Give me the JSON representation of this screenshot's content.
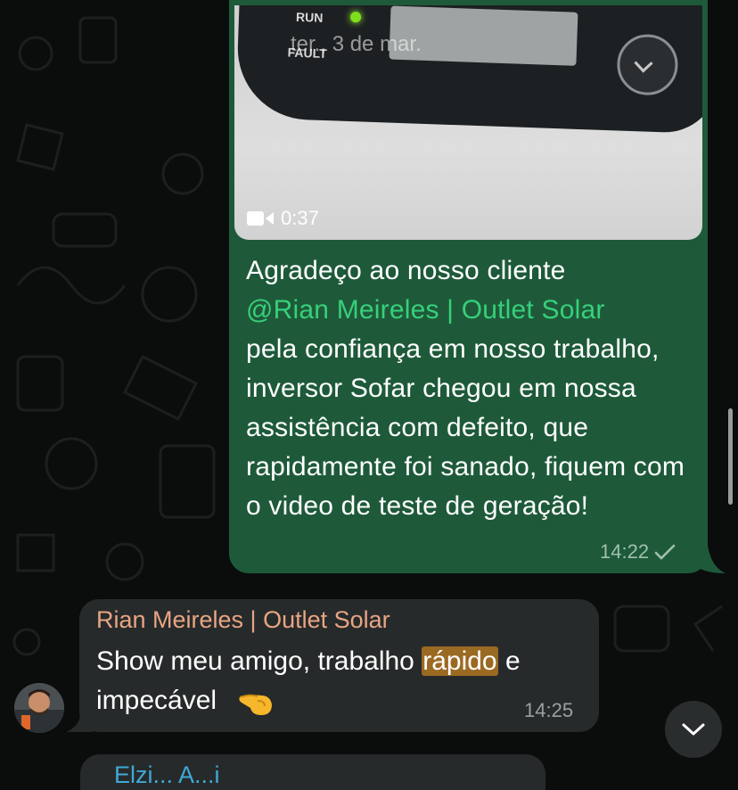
{
  "outgoing": {
    "video": {
      "duration": "0:37",
      "date_overlay": "ter., 3 de mar.",
      "device_labels": [
        "RUN",
        "FAULT"
      ]
    },
    "text_before": "Agradeço ao nosso cliente",
    "mention": "@Rian Meireles | Outlet Solar",
    "text_after": "pela confiança em nosso trabalho, inversor Sofar chegou em nossa assistência com defeito, que rapidamente foi sanado, fiquem com o video de teste de geração!",
    "time": "14:22",
    "status": "sent"
  },
  "incoming": {
    "sender": "Rian Meireles | Outlet Solar",
    "text_before": "Show meu amigo, trabalho ",
    "highlighted": "rápido",
    "text_after": " e impecável",
    "emoji": "pointing-left",
    "time": "14:25"
  },
  "next_message": {
    "sender_partial": "Elzi...  A...i"
  },
  "colors": {
    "background": "#0b0d0c",
    "outgoing_bubble": "#1e5a3a",
    "incoming_bubble": "#272a2b",
    "mention": "#37d07a",
    "sender_name": "#e8a583",
    "highlight": "#9b6a22"
  }
}
